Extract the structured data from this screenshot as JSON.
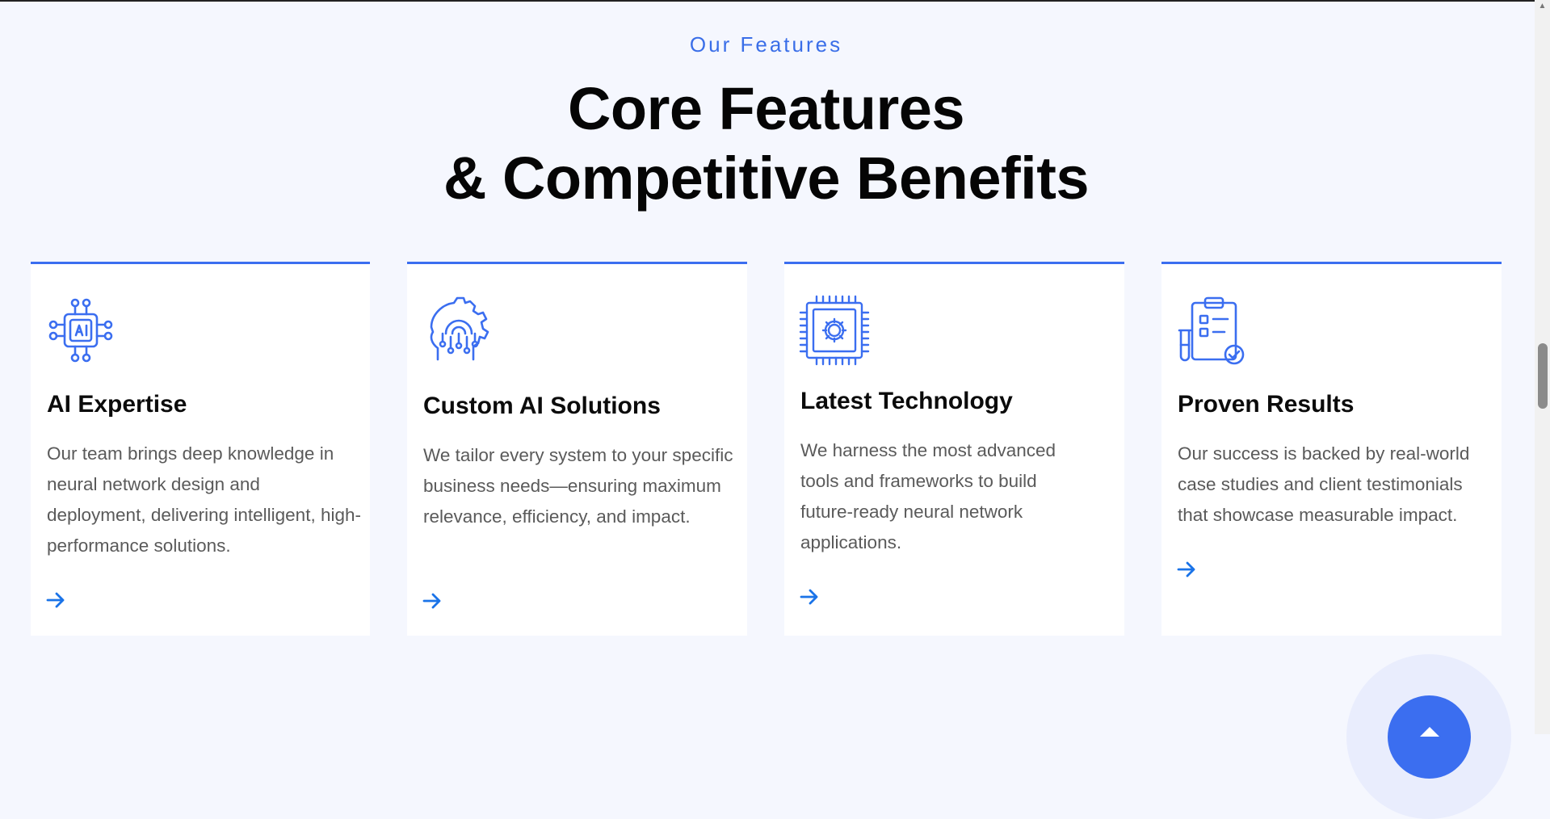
{
  "section": {
    "eyebrow": "Our Features",
    "title_line1": "Core Features",
    "title_line2": "& Competitive Benefits"
  },
  "cards": [
    {
      "icon": "ai-chip-icon",
      "title": "AI Expertise",
      "description": "Our team brings deep knowledge in neural network design and deployment, delivering intelligent, high-performance solutions.",
      "link_icon": "arrow-right-icon"
    },
    {
      "icon": "head-circuit-gear-icon",
      "title": "Custom AI Solutions",
      "description": "We tailor every system to your specific business needs—ensuring maximum relevance, efficiency, and impact.",
      "link_icon": "arrow-right-icon"
    },
    {
      "icon": "processor-gear-icon",
      "title": "Latest Technology",
      "description": "We harness the most advanced tools and frameworks to build future-ready neural network applications.",
      "link_icon": "arrow-right-icon"
    },
    {
      "icon": "clipboard-checklist-icon",
      "title": "Proven Results",
      "description": "Our success is backed by real-world case studies and client testimonials that showcase measurable impact.",
      "link_icon": "arrow-right-icon"
    }
  ],
  "floating_button": {
    "icon": "chevron-up-icon"
  },
  "colors": {
    "accent": "#3b6ef0",
    "eyebrow": "#3a6ee8",
    "page_background": "#f5f7fe",
    "card_background": "#ffffff",
    "body_text": "#5a5a5a",
    "arrow": "#1a73e8"
  }
}
